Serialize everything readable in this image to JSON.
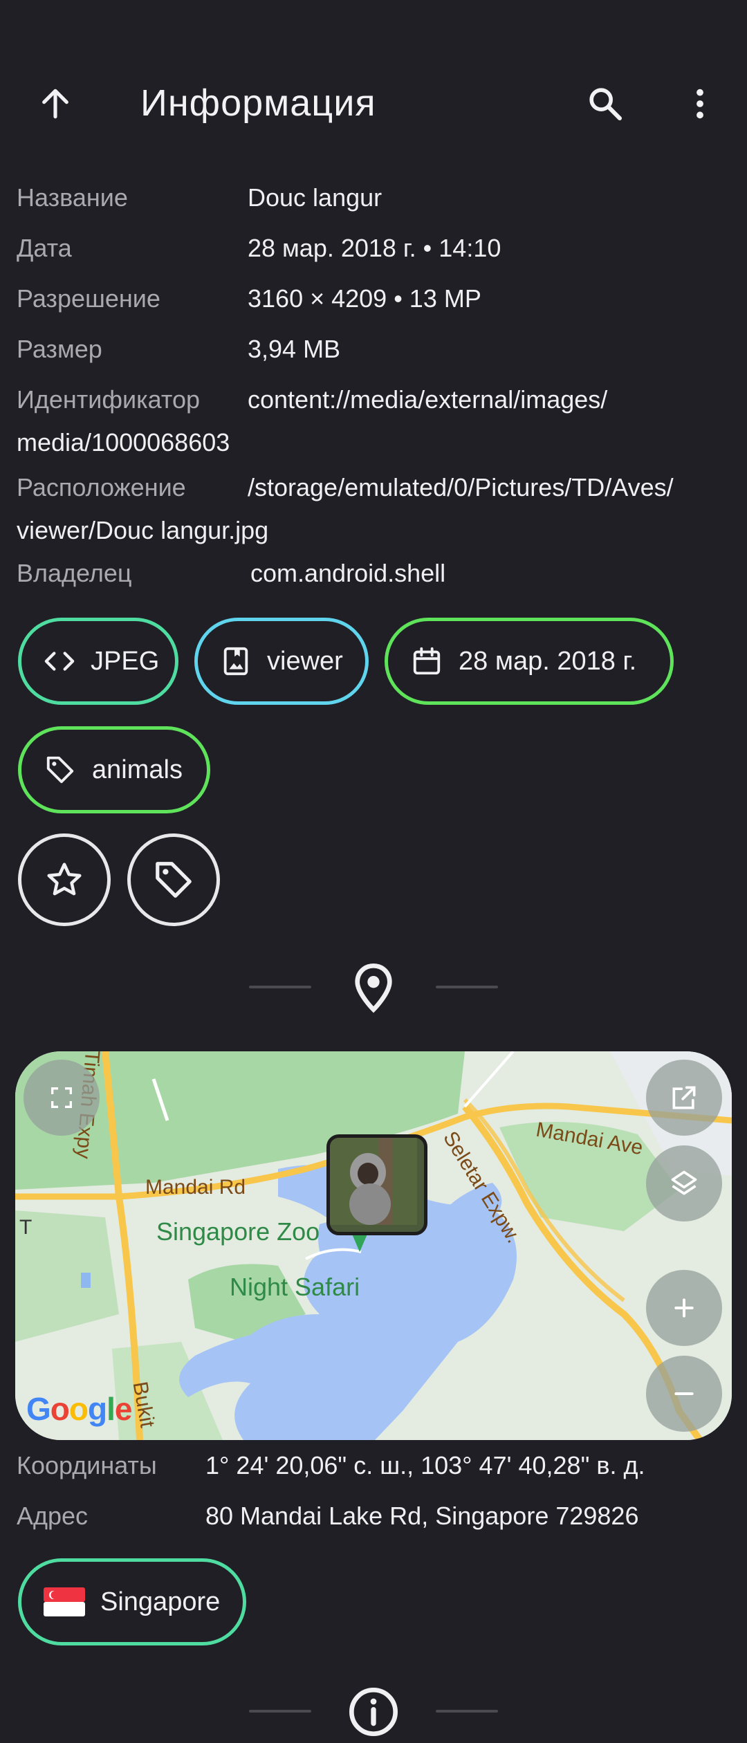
{
  "header": {
    "title": "Информация"
  },
  "info": {
    "title_label": "Название",
    "title_value": "Douc langur",
    "date_label": "Дата",
    "date_value": "28 мар. 2018 г. • 14:10",
    "resolution_label": "Разрешение",
    "resolution_value": "3160 × 4209 • 13 MP",
    "size_label": "Размер",
    "size_value": "3,94 MB",
    "id_label": "Идентификатор",
    "id_value_line1": "content://media/external/images/",
    "id_value_line2": "media/1000068603",
    "location_label": "Расположение",
    "location_value_line1": "/storage/emulated/0/Pictures/TD/Aves/",
    "location_value_line2": "viewer/Douc langur.jpg",
    "owner_label": "Владелец",
    "owner_value": "com.android.shell"
  },
  "chips": {
    "format": "JPEG",
    "album": "viewer",
    "date": "28 мар. 2018 г.",
    "tag": "animals",
    "country": "Singapore",
    "country_flag": "🇸🇬"
  },
  "map": {
    "labels": {
      "mandai_rd": "Mandai Rd",
      "mandai_ave": "Mandai Ave",
      "seletar": "Seletar Expw.",
      "timah": "Timah Expy",
      "bukit": "Bukit",
      "zoo": "Singapore Zoo",
      "night_safari": "Night Safari",
      "t": "T"
    },
    "google_letters": [
      "G",
      "o",
      "o",
      "g",
      "l",
      "e"
    ]
  },
  "location": {
    "coords_label": "Координаты",
    "coords_value": "1° 24' 20,06\" с. ш., 103° 47' 40,28\" в. д.",
    "address_label": "Адрес",
    "address_value": "80 Mandai Lake Rd, Singapore 729826"
  },
  "colors": {
    "background": "#1f1f25",
    "chip_green": "#4fd87f",
    "chip_teal": "#4fd8c8",
    "chip_cyan": "#5fd4ec",
    "chip_lime": "#5ee35a",
    "chip_mint": "#4fdca0"
  }
}
